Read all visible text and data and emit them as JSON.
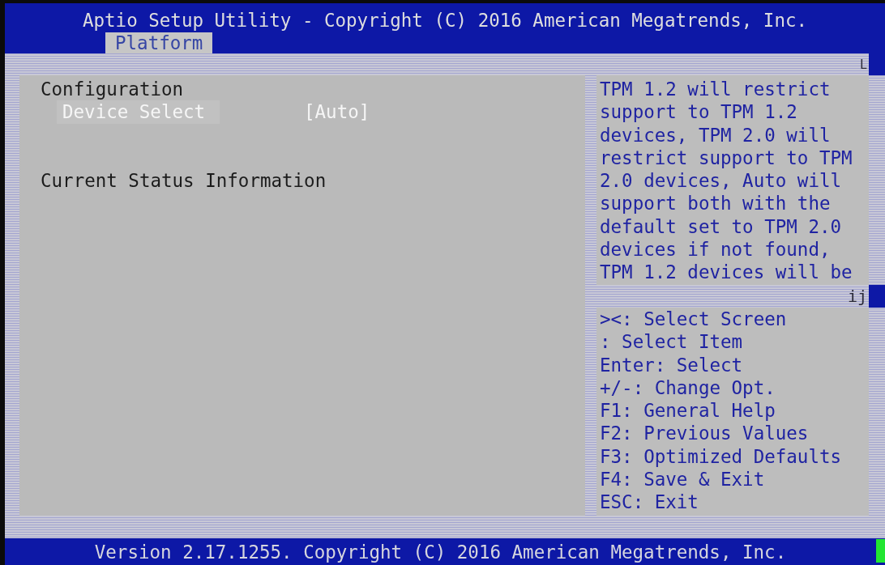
{
  "header": {
    "title": "Aptio Setup Utility - Copyright (C) 2016 American Megatrends, Inc.",
    "tabs": [
      {
        "label": "Platform",
        "selected": true
      }
    ]
  },
  "setup_menu": {
    "items": [
      {
        "kind": "heading",
        "label": "Configuration"
      },
      {
        "kind": "setting",
        "label": "Device Select",
        "value": "[Auto]",
        "selected": true
      },
      {
        "kind": "heading",
        "label": "Current Status Information"
      }
    ]
  },
  "scrollbar": {
    "top_glyph": "L",
    "divider_glyph": "ij"
  },
  "help_panel": {
    "text": "TPM 1.2 will restrict support to TPM 1.2 devices, TPM 2.0 will restrict support to TPM 2.0 devices, Auto will support both with the default set to TPM 2.0 devices if not found, TPM 1.2 devices will be"
  },
  "key_legend": [
    "><: Select Screen",
    ": Select Item",
    "Enter: Select",
    "+/-: Change Opt.",
    "F1: General Help",
    "F2: Previous Values",
    "F3: Optimized Defaults",
    "F4: Save & Exit",
    "ESC: Exit"
  ],
  "footer": {
    "text": "Version 2.17.1255. Copyright (C) 2016 American Megatrends, Inc."
  }
}
